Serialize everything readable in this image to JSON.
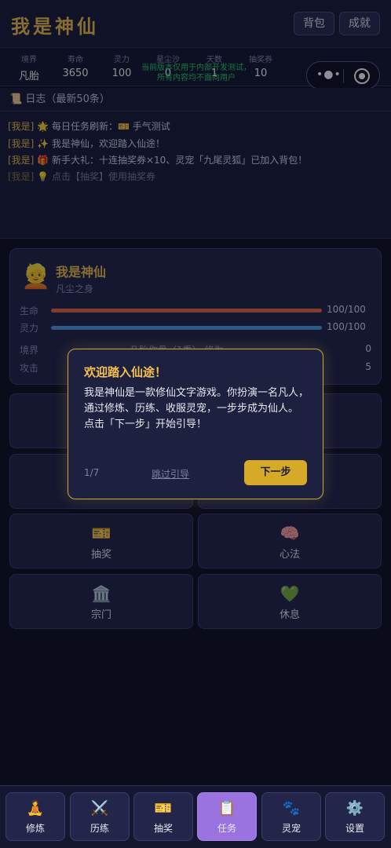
{
  "header": {
    "title": "我是神仙",
    "bag_label": "背包",
    "achievements_label": "成就"
  },
  "stats": [
    {
      "label": "境界",
      "value": "凡胎"
    },
    {
      "label": "寿命",
      "value": "3650"
    },
    {
      "label": "灵力",
      "value": "100"
    },
    {
      "label": "星尘沙",
      "value": "0"
    },
    {
      "label": "天数",
      "value": "1"
    },
    {
      "label": "抽奖券",
      "value": "10"
    }
  ],
  "dev_notice": {
    "line1": "当前版本仅用于内部开发测试，",
    "line2": "所有内容均不面向用户"
  },
  "log": {
    "title": "📜 日志（最新50条）",
    "entries": [
      {
        "tag": "[我是]",
        "text": " 🌟 每日任务刷新：🎫 手气测试"
      },
      {
        "tag": "[我是]",
        "text": " ✨ 我是神仙，欢迎踏入仙途！"
      },
      {
        "tag": "[我是]",
        "text": " 🎁 新手大礼：十连抽奖券×10、灵宠「九尾灵狐」已加入背包！"
      },
      {
        "tag": "[我是]",
        "text": " 💡 点击【抽奖】使用抽奖券"
      }
    ]
  },
  "character": {
    "avatar": "👱",
    "name": "我是神仙",
    "subtitle": "凡尘之身",
    "hp": {
      "label": "生命",
      "value": "100/100",
      "fraction": 1.0,
      "color": "#e8694a"
    },
    "mp": {
      "label": "灵力",
      "value": "100/100",
      "fraction": 1.0,
      "color": "#4f9de8"
    },
    "realm": {
      "label": "境界",
      "middle": "凡胎你骨（1重）",
      "middle_suffix": "修为",
      "value": "0"
    },
    "attack": {
      "label": "攻击",
      "value": "5"
    }
  },
  "actions": [
    {
      "icon": "🎫",
      "label": "抽奖"
    },
    {
      "icon": "🧠",
      "label": "心法"
    },
    {
      "icon": "🏛️",
      "label": "宗门"
    },
    {
      "icon": "💚",
      "label": "休息"
    }
  ],
  "guide": {
    "title": "欢迎踏入仙途！",
    "body_line1": "我是神仙是一款修仙文字游戏。你扮演一名凡人，通过修炼、历练、收服灵宠，一步步成为仙人。",
    "body_line2": "点击「下一步」开始引导！",
    "step": "1/7",
    "skip_label": "跳过引导",
    "next_label": "下一步"
  },
  "tabs": [
    {
      "icon": "🧘",
      "label": "修炼"
    },
    {
      "icon": "⚔️",
      "label": "历练"
    },
    {
      "icon": "🎫",
      "label": "抽奖"
    },
    {
      "icon": "📋",
      "label": "任务",
      "active": true
    },
    {
      "icon": "🐾",
      "label": "灵宠"
    },
    {
      "icon": "⚙️",
      "label": "设置"
    }
  ]
}
